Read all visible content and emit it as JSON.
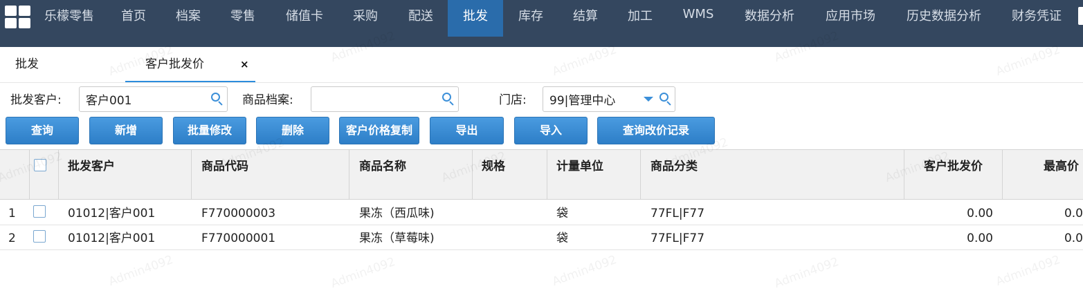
{
  "app": {
    "brand": "乐檬零售",
    "nav": [
      "首页",
      "档案",
      "零售",
      "储值卡",
      "采购",
      "配送",
      "批发",
      "库存",
      "结算",
      "加工",
      "WMS",
      "数据分析",
      "应用市场",
      "历史数据分析",
      "财务凭证"
    ],
    "active_nav": "批发"
  },
  "tabs": [
    {
      "label": "批发"
    },
    {
      "label": "客户批发价",
      "close": "×"
    }
  ],
  "filters": {
    "customer": {
      "label": "批发客户:",
      "value": "客户001"
    },
    "product": {
      "label": "商品档案:",
      "value": ""
    },
    "store": {
      "label": "门店:",
      "value": "99|管理中心"
    }
  },
  "buttons": {
    "query": "查询",
    "add": "新增",
    "batch_edit": "批量修改",
    "delete": "删除",
    "copy_price": "客户价格复制",
    "export": "导出",
    "import": "导入",
    "price_log": "查询改价记录"
  },
  "grid": {
    "columns": {
      "customer": "批发客户",
      "code": "商品代码",
      "name": "商品名称",
      "spec": "规格",
      "unit": "计量单位",
      "category": "商品分类",
      "price": "客户批发价",
      "max_price": "最高价"
    },
    "rows": [
      {
        "idx": "1",
        "customer": "01012|客户001",
        "code": "F770000003",
        "name": "果冻（西瓜味)",
        "spec": "",
        "unit": "袋",
        "category": "77FL|F77",
        "price": "0.00",
        "max_price": "0.0"
      },
      {
        "idx": "2",
        "customer": "01012|客户001",
        "code": "F770000001",
        "name": "果冻（草莓味)",
        "spec": "",
        "unit": "袋",
        "category": "77FL|F77",
        "price": "0.00",
        "max_price": "0.0"
      }
    ]
  },
  "watermark": "Admin4092",
  "colors": {
    "nav_bg": "#34475f",
    "nav_active": "#2a6cab",
    "button": "#2d7ec7",
    "accent": "#3b8fd9"
  }
}
